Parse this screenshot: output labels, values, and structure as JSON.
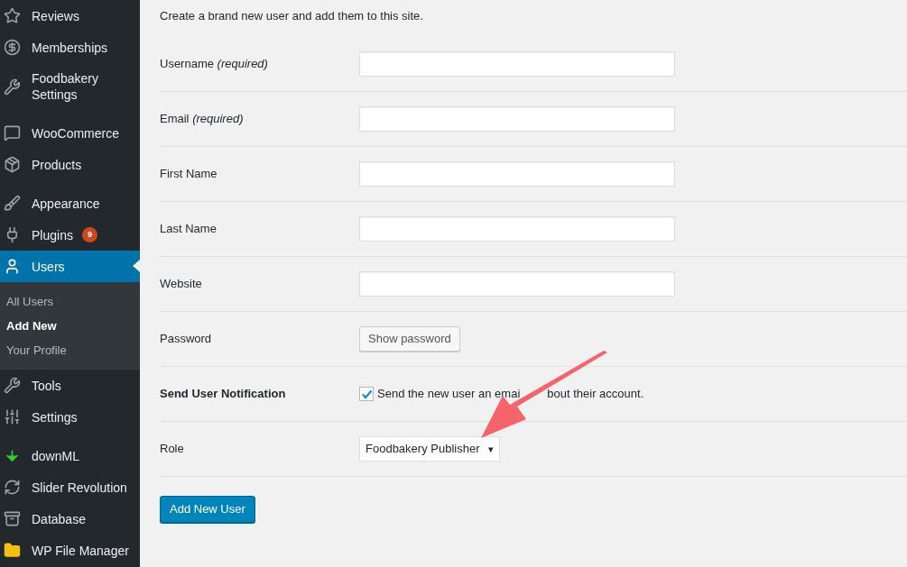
{
  "sidebar": {
    "groups": [
      [
        {
          "label": "Reviews",
          "selected": false
        },
        {
          "label": "Memberships",
          "selected": false
        },
        {
          "label": "Foodbakery Settings",
          "selected": false
        }
      ],
      [
        {
          "label": "WooCommerce",
          "selected": false
        },
        {
          "label": "Products",
          "selected": false
        }
      ],
      [
        {
          "label": "Appearance",
          "selected": false
        },
        {
          "label": "Plugins",
          "badge": "9",
          "selected": false
        },
        {
          "label": "Users",
          "selected": true,
          "children": [
            {
              "label": "All Users",
              "selected": false
            },
            {
              "label": "Add New",
              "selected": true
            },
            {
              "label": "Your Profile",
              "selected": false
            }
          ]
        },
        {
          "label": "Tools",
          "selected": false
        },
        {
          "label": "Settings",
          "selected": false
        }
      ],
      [
        {
          "label": "downML",
          "selected": false
        },
        {
          "label": "Slider Revolution",
          "selected": false
        },
        {
          "label": "Database",
          "selected": false
        },
        {
          "label": "WP File Manager",
          "selected": false
        }
      ]
    ]
  },
  "intro": "Create a brand new user and add them to this site.",
  "form": {
    "rows": [
      {
        "kind": "text",
        "label": "Username *(required)*"
      },
      {
        "kind": "text",
        "label": "Email *(required)*"
      },
      {
        "kind": "text",
        "label": "First Name"
      },
      {
        "kind": "text",
        "label": "Last Name"
      },
      {
        "kind": "text",
        "label": "Website"
      },
      {
        "kind": "button",
        "label": "Password",
        "button": "Show password"
      },
      {
        "kind": "checkbox",
        "label": "Send User Notification",
        "text_before": "Send the new user an emai",
        "text_after": "bout their account.",
        "checked": true
      },
      {
        "kind": "select",
        "label": "Role",
        "value": "Foodbakery Publisher",
        "caret": "▾"
      }
    ]
  },
  "submit": "Add New User"
}
